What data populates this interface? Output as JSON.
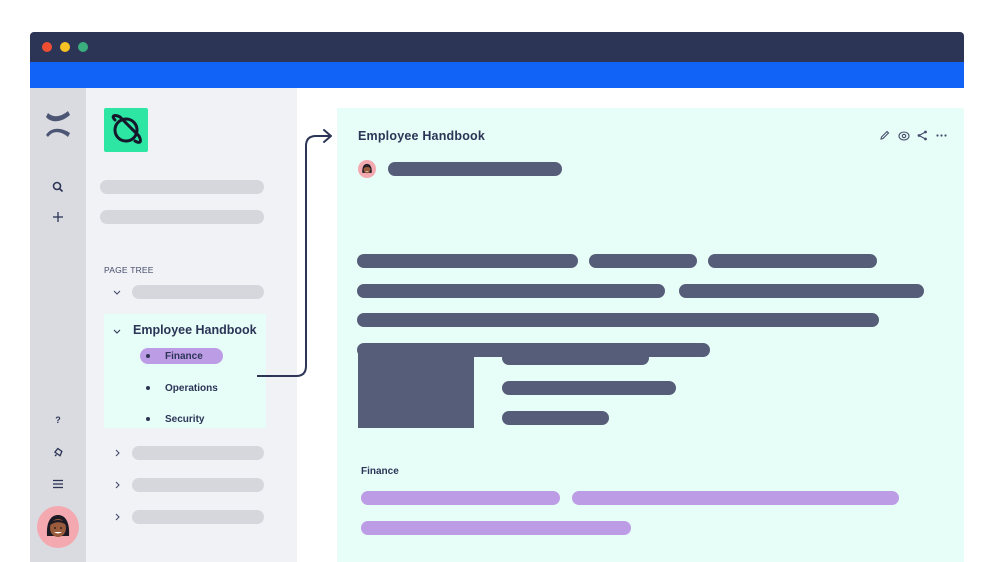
{
  "window": {
    "controls": [
      {
        "name": "close",
        "color": "#ef4e33"
      },
      {
        "name": "minimize",
        "color": "#f6c223"
      },
      {
        "name": "maximize",
        "color": "#3aae7e"
      }
    ],
    "titlebar_color": "#2c3556",
    "header_color": "#1163f8"
  },
  "rail": {
    "logo_icon": "confluence-logo-icon",
    "top_icons": [
      {
        "name": "search-icon",
        "glyph": "search"
      },
      {
        "name": "plus-icon",
        "glyph": "+"
      }
    ],
    "bottom_icons": [
      {
        "name": "help-icon",
        "glyph": "?"
      },
      {
        "name": "notification-icon",
        "glyph": "bell"
      },
      {
        "name": "menu-icon",
        "glyph": "≡"
      }
    ],
    "avatar": "user-avatar"
  },
  "sidebar": {
    "space_logo": "planet-icon",
    "page_tree_label": "PAGE TREE",
    "active_page": {
      "title": "Employee Handbook",
      "children": [
        {
          "label": "Finance",
          "selected": true
        },
        {
          "label": "Operations",
          "selected": false
        },
        {
          "label": "Security",
          "selected": false
        }
      ]
    },
    "accent_color": "#bd9ce6",
    "active_bg": "#e6fdf8"
  },
  "page": {
    "title": "Employee Handbook",
    "toolbar": [
      {
        "name": "edit-icon",
        "glyph": "pencil"
      },
      {
        "name": "watch-icon",
        "glyph": "eye"
      },
      {
        "name": "share-icon",
        "glyph": "share"
      },
      {
        "name": "more-icon",
        "glyph": "…"
      }
    ],
    "section_label": "Finance"
  }
}
